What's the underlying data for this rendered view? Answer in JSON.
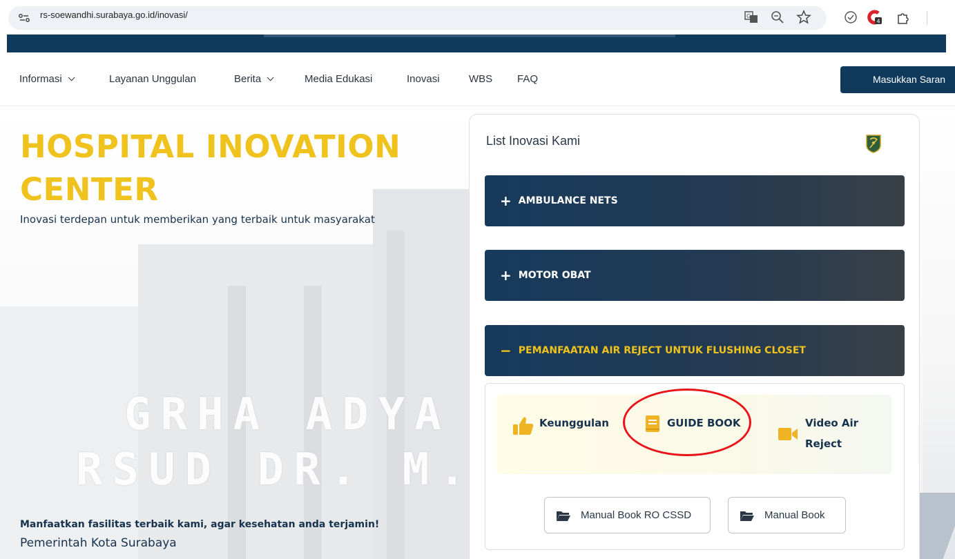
{
  "browser": {
    "url": "rs-soewandhi.surabaya.go.id/inovasi/",
    "extension_badge": "4",
    "icons": [
      "site-info-icon",
      "translate-icon",
      "zoom-icon",
      "bookmark-star-icon",
      "shield-check-icon",
      "extension-red-icon",
      "puzzle-icon"
    ]
  },
  "nav": {
    "items": [
      {
        "label": "Informasi",
        "dropdown": true
      },
      {
        "label": "Layanan Unggulan",
        "dropdown": false
      },
      {
        "label": "Berita",
        "dropdown": true
      },
      {
        "label": "Media Edukasi",
        "dropdown": false
      },
      {
        "label": "Inovasi",
        "dropdown": false
      },
      {
        "label": "WBS",
        "dropdown": false
      },
      {
        "label": "FAQ",
        "dropdown": false
      }
    ],
    "cta_label": "Masukkan Saran"
  },
  "hero": {
    "title": "HOSPITAL INOVATION CENTER",
    "subtitle": "Inovasi terdepan untuk memberikan yang terbaik untuk masyarakat",
    "tagline": "Manfaatkan fasilitas terbaik kami, agar kesehatan anda terjamin!",
    "government": "Pemerintah Kota Surabaya",
    "building_text_1": "GRHA ADYA",
    "building_text_2": "RSUD DR. M. SOEW"
  },
  "panel": {
    "title": "List Inovasi Kami",
    "accordions": [
      {
        "label": "AMBULANCE NETS",
        "sign": "+",
        "open": false
      },
      {
        "label": "MOTOR OBAT",
        "sign": "+",
        "open": false
      },
      {
        "label": "PEMANFAATAN AIR REJECT UNTUK FLUSHING CLOSET",
        "sign": "−",
        "open": true
      }
    ],
    "features": [
      {
        "label": "Keunggulan",
        "icon": "thumbs-up-icon"
      },
      {
        "label": "GUIDE BOOK",
        "icon": "book-icon"
      },
      {
        "label": "Video Air Reject",
        "icon": "video-camera-icon"
      }
    ],
    "files": [
      {
        "label": "Manual Book RO CSSD",
        "icon": "folder-open-icon"
      },
      {
        "label": "Manual Book",
        "icon": "folder-open-icon"
      }
    ]
  },
  "colors": {
    "brand_navy": "#0f3a5c",
    "accent_yellow": "#f0c21d",
    "highlight_red": "#e8141a"
  }
}
